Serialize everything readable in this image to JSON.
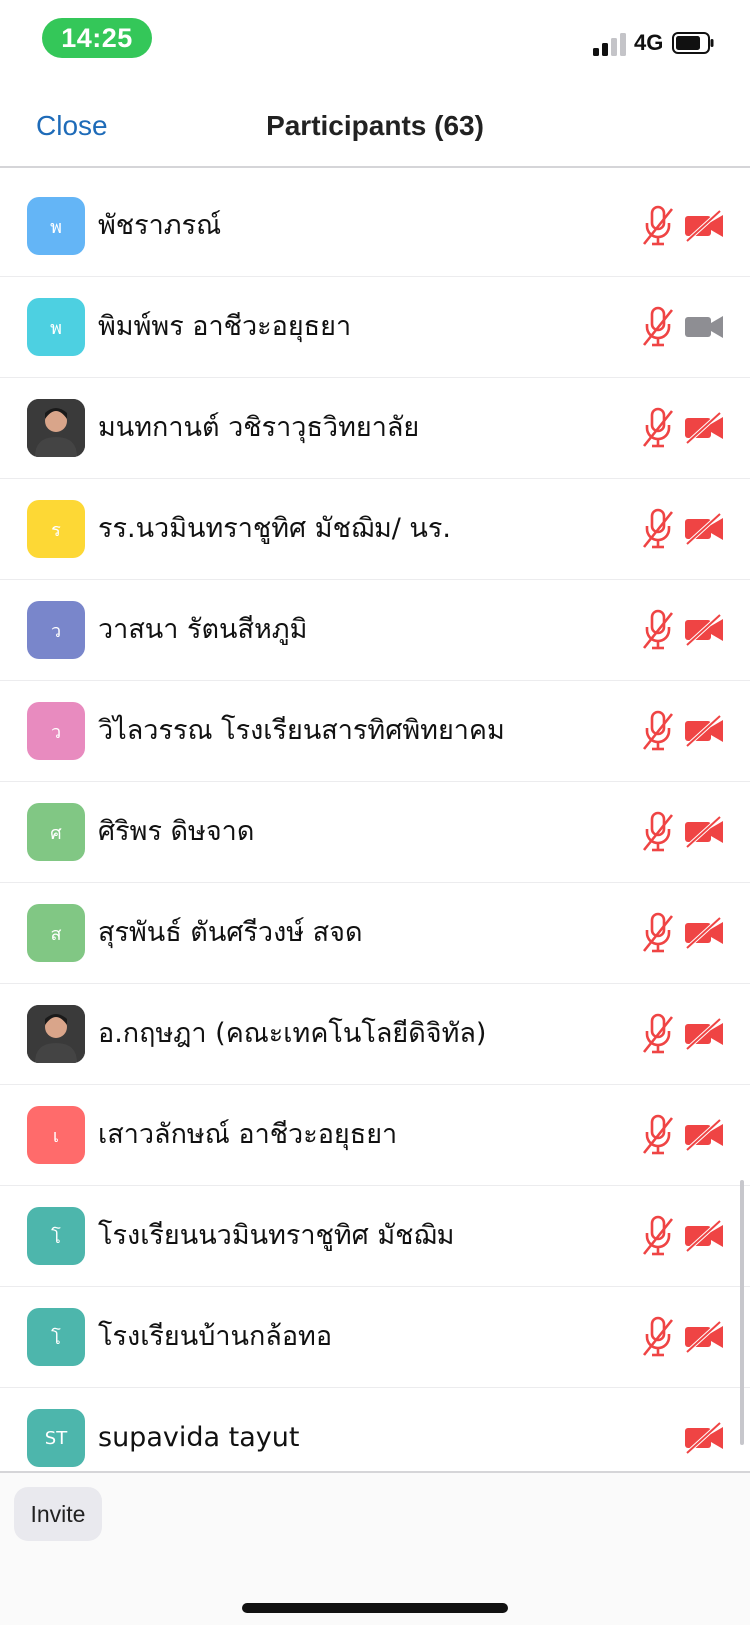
{
  "status_bar": {
    "time": "14:25",
    "network": "4G",
    "time_pill_color": "#34c759"
  },
  "nav": {
    "close_label": "Close",
    "title": "Participants (63)"
  },
  "participants": [
    {
      "initial": "พ",
      "name": "พัชราภรณ์",
      "avatar_color": "#64b5f6",
      "avatar_type": "initial",
      "mic": "muted",
      "video": "off"
    },
    {
      "initial": "พ",
      "name": "พิมพ์พร อาชีวะอยุธยา",
      "avatar_color": "#4dd0e1",
      "avatar_type": "initial",
      "mic": "muted",
      "video": "unavailable"
    },
    {
      "initial": "",
      "name": "มนทกานต์ วชิราวุธวิทยาลัย",
      "avatar_color": "#2a2a2a",
      "avatar_type": "photo",
      "mic": "muted",
      "video": "off"
    },
    {
      "initial": "ร",
      "name": "รร.นวมินทราชูทิศ มัชฌิม/ นร.",
      "avatar_color": "#fdd835",
      "avatar_type": "initial",
      "mic": "muted",
      "video": "off"
    },
    {
      "initial": "ว",
      "name": "วาสนา รัตนสีหภูมิ",
      "avatar_color": "#7986cb",
      "avatar_type": "initial",
      "mic": "muted",
      "video": "off"
    },
    {
      "initial": "ว",
      "name": "วิไลวรรณ โรงเรียนสารทิศพิทยาคม",
      "avatar_color": "#e88bbf",
      "avatar_type": "initial",
      "mic": "muted",
      "video": "off"
    },
    {
      "initial": "ศ",
      "name": "ศิริพร ดิษจาด",
      "avatar_color": "#81c784",
      "avatar_type": "initial",
      "mic": "muted",
      "video": "off"
    },
    {
      "initial": "ส",
      "name": "สุรพันธ์ ตันศรีวงษ์  สจด",
      "avatar_color": "#81c784",
      "avatar_type": "initial",
      "mic": "muted",
      "video": "off"
    },
    {
      "initial": "",
      "name": "อ.กฤษฎา (คณะเทคโนโลยีดิจิทัล)",
      "avatar_color": "#1f1f1f",
      "avatar_type": "photo",
      "mic": "muted",
      "video": "off"
    },
    {
      "initial": "เ",
      "name": "เสาวลักษณ์  อาชีวะอยุธยา",
      "avatar_color": "#ff6b6b",
      "avatar_type": "initial",
      "mic": "muted",
      "video": "off"
    },
    {
      "initial": "โ",
      "name": "โรงเรียนนวมินทราชูทิศ มัชฌิม",
      "avatar_color": "#4db6ac",
      "avatar_type": "initial",
      "mic": "muted",
      "video": "off"
    },
    {
      "initial": "โ",
      "name": "โรงเรียนบ้านกล้อทอ",
      "avatar_color": "#4db6ac",
      "avatar_type": "initial",
      "mic": "muted",
      "video": "off"
    },
    {
      "initial": "ST",
      "name": "supavida tayut",
      "avatar_color": "#4db6ac",
      "avatar_type": "initial",
      "mic": "none",
      "video": "off"
    }
  ],
  "footer": {
    "invite_label": "Invite"
  },
  "colors": {
    "muted_red": "#ef4444",
    "disabled_gray": "#8e8e93",
    "link_blue": "#1e6bb8"
  }
}
